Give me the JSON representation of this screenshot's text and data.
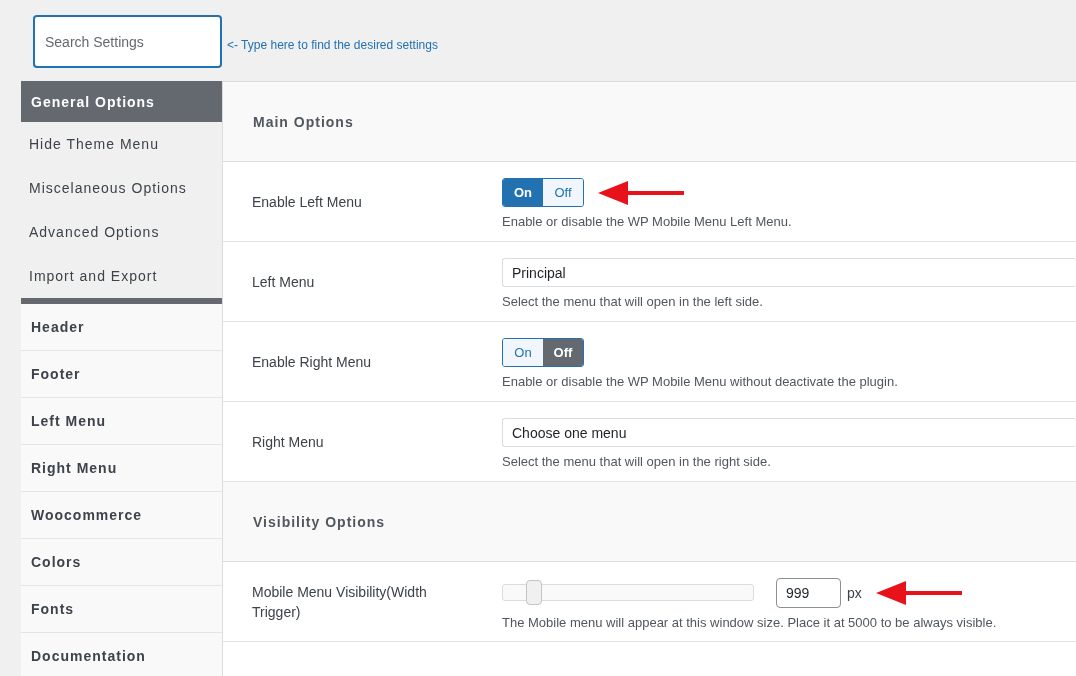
{
  "search": {
    "placeholder": "Search Settings",
    "hint": "<- Type here to find the desired settings"
  },
  "sidebar": {
    "items": [
      {
        "label": "General Options",
        "selected": true,
        "children": [
          {
            "label": "Hide Theme Menu",
            "selected": false
          },
          {
            "label": "Miscelaneous Options",
            "selected": false
          },
          {
            "label": "Advanced Options",
            "selected": false
          },
          {
            "label": "Import and Export",
            "selected": false
          }
        ]
      },
      {
        "label": "Header",
        "selected": false
      },
      {
        "label": "Footer",
        "selected": false
      },
      {
        "label": "Left Menu",
        "selected": false
      },
      {
        "label": "Right Menu",
        "selected": false
      },
      {
        "label": "Woocommerce",
        "selected": false
      },
      {
        "label": "Colors",
        "selected": false
      },
      {
        "label": "Fonts",
        "selected": false
      },
      {
        "label": "Documentation",
        "selected": false
      }
    ]
  },
  "sections": [
    {
      "title": "Main Options",
      "rows": [
        {
          "kind": "toggle",
          "label": "Enable Left Menu",
          "options": [
            {
              "label": "On",
              "selected": true
            },
            {
              "label": "Off",
              "selected": false
            }
          ],
          "description": "Enable or disable the WP Mobile Menu Left Menu.",
          "marked": true
        },
        {
          "kind": "select",
          "label": "Left Menu",
          "value": "Principal",
          "description": "Select the menu that will open in the left side.",
          "marked": false
        },
        {
          "kind": "toggle",
          "label": "Enable Right Menu",
          "options": [
            {
              "label": "On",
              "selected": false
            },
            {
              "label": "Off",
              "selected": true
            }
          ],
          "description": "Enable or disable the WP Mobile Menu without deactivate the plugin.",
          "marked": false
        },
        {
          "kind": "select",
          "label": "Right Menu",
          "value": "Choose one menu",
          "description": "Select the menu that will open in the right side.",
          "marked": false
        }
      ]
    },
    {
      "title": "Visibility Options",
      "rows": [
        {
          "kind": "slider",
          "label": "Mobile Menu Visibility(Width Trigger)",
          "level": 0.1,
          "value": "999",
          "unit": "px",
          "description": "The Mobile menu will appear at this window size. Place it at 5000 to be always visible.",
          "marked": true
        }
      ]
    }
  ]
}
